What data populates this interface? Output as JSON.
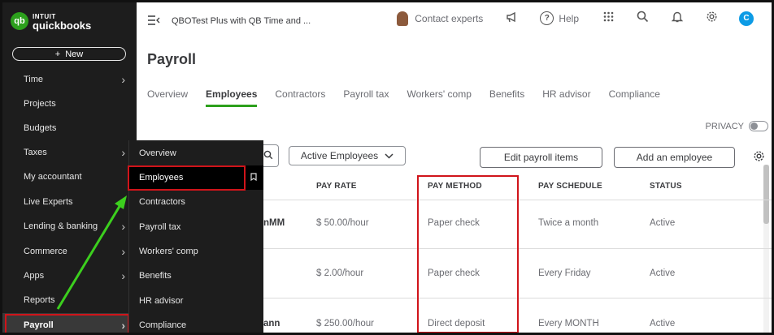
{
  "app": {
    "logo_badge": "qb",
    "logo_brand": "INTUIT",
    "logo_name": "quickbooks",
    "company_name": "QBOTest Plus with QB Time and ...",
    "new_button": "New"
  },
  "sidebar": {
    "items": [
      {
        "label": "Time",
        "chevron": true
      },
      {
        "label": "Projects",
        "chevron": false
      },
      {
        "label": "Budgets",
        "chevron": false
      },
      {
        "label": "Taxes",
        "chevron": true
      },
      {
        "label": "My accountant",
        "chevron": false
      },
      {
        "label": "Live Experts",
        "chevron": false
      },
      {
        "label": "Lending & banking",
        "chevron": true
      },
      {
        "label": "Commerce",
        "chevron": true
      },
      {
        "label": "Apps",
        "chevron": true
      },
      {
        "label": "Reports",
        "chevron": false
      },
      {
        "label": "Payroll",
        "chevron": true
      }
    ]
  },
  "flyout": {
    "items": [
      "Overview",
      "Employees",
      "Contractors",
      "Payroll tax",
      "Workers' comp",
      "Benefits",
      "HR advisor",
      "Compliance"
    ]
  },
  "topbar": {
    "contact_label": "Contact experts",
    "help_label": "Help",
    "user_initial": "C",
    "icons": [
      "menu-collapse-icon",
      "megaphone-icon",
      "help-icon",
      "apps-grid-icon",
      "search-icon",
      "bell-icon",
      "gear-icon"
    ]
  },
  "page": {
    "title": "Payroll",
    "tabs": [
      "Overview",
      "Employees",
      "Contractors",
      "Payroll tax",
      "Workers' comp",
      "Benefits",
      "HR advisor",
      "Compliance"
    ],
    "active_tab": "Employees",
    "privacy_label": "PRIVACY",
    "filter_value": "Active Employees",
    "edit_payroll_items": "Edit payroll items",
    "add_employee": "Add an employee"
  },
  "table": {
    "columns": [
      "PAY RATE",
      "PAY METHOD",
      "PAY SCHEDULE",
      "STATUS"
    ],
    "rows": [
      {
        "name": "nMM",
        "pay_rate": "$ 50.00/hour",
        "pay_method": "Paper check",
        "pay_schedule": "Twice a month",
        "status": "Active"
      },
      {
        "name": "",
        "pay_rate": "$ 2.00/hour",
        "pay_method": "Paper check",
        "pay_schedule": "Every Friday",
        "status": "Active"
      },
      {
        "name": "ann",
        "pay_rate": "$ 250.00/hour",
        "pay_method": "Direct deposit",
        "pay_schedule": "Every MONTH",
        "status": "Active"
      }
    ]
  },
  "colors": {
    "sidebar_bg": "#1d1d1d",
    "accent_green": "#2ca01c",
    "highlight_red": "#d0141a",
    "arrow_green": "#3ccf1e",
    "user_avatar_blue": "#0d9be5"
  }
}
